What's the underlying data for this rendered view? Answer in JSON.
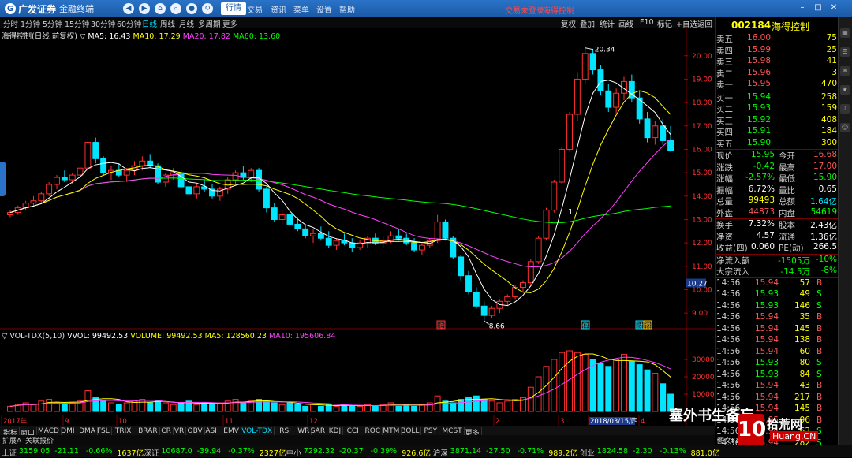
{
  "app": {
    "brand": "广发证券",
    "product": "金融终端"
  },
  "menu": [
    "行情",
    "交易",
    "资讯",
    "菜单",
    "设置",
    "帮助"
  ],
  "menu_active": "行情",
  "top_links": {
    "login": "交易未登录",
    "stock": "海得控制"
  },
  "periods": [
    "分时",
    "1分钟",
    "5分钟",
    "15分钟",
    "30分钟",
    "60分钟",
    "日线",
    "周线",
    "月线",
    "多周期",
    "更多"
  ],
  "period_active": "日线",
  "right_tools": [
    "复权",
    "叠加",
    "统计",
    "画线",
    "F10",
    "标记",
    "+自选",
    "返回"
  ],
  "stock": {
    "code": "002184",
    "name": "海得控制"
  },
  "chart_info": {
    "name": "海得控制(日线 前复权)",
    "ma5_label": "MA5: 16.43",
    "ma10_label": "MA10: 17.29",
    "ma20_label": "MA20: 17.82",
    "ma60_label": "MA60: 13.60"
  },
  "vol_info": {
    "name": "VOL-TDX(5,10)",
    "vvol": "VVOL: 99492.53",
    "volume": "VOLUME: 99492.53",
    "ma5": "MA5: 128560.23",
    "ma10": "MA10: 195606.84"
  },
  "annotations": {
    "high": "20.34",
    "low": "8.66",
    "cursor": "10.27",
    "marker1": "1",
    "ev1": "增",
    "ev2": "停",
    "ev3": "财",
    "ev4": "腾"
  },
  "price_axis": [
    "20.00",
    "19.00",
    "18.00",
    "17.00",
    "16.00",
    "15.00",
    "14.00",
    "13.00",
    "12.00",
    "11.00",
    "10.00",
    "9.00"
  ],
  "vol_axis": [
    "30000",
    "20000",
    "10000"
  ],
  "time_axis": [
    "2017年",
    "9",
    "10",
    "11",
    "12",
    "2",
    "3",
    "2018/03/15/四",
    "4"
  ],
  "tabs": [
    "指标",
    "窗口",
    "MACD",
    "DMI",
    "DMA",
    "FSL",
    "TRIX",
    "BRAR",
    "CR",
    "VR",
    "OBV",
    "ASI",
    "EMV",
    "VOL-TDX",
    "RSI",
    "WR",
    "SAR",
    "KDJ",
    "CCI",
    "ROC",
    "MTM",
    "BOLL",
    "PSY",
    "MCST",
    "更多"
  ],
  "tab_active": "VOL-TDX",
  "ext_bar": {
    "left": "扩展A",
    "mid": "关联报价"
  },
  "colors": {
    "up": "#ff3030",
    "down": "#00e5ff",
    "ma5": "#ffffff",
    "ma10": "#ffff00",
    "ma20": "#ff40ff",
    "ma60": "#00ff00"
  },
  "order_book": {
    "asks": [
      {
        "label": "卖五",
        "price": "16.00",
        "vol": "75"
      },
      {
        "label": "卖四",
        "price": "15.99",
        "vol": "25"
      },
      {
        "label": "卖三",
        "price": "15.98",
        "vol": "41"
      },
      {
        "label": "卖二",
        "price": "15.96",
        "vol": "3"
      },
      {
        "label": "卖一",
        "price": "15.95",
        "vol": "470"
      }
    ],
    "bids": [
      {
        "label": "买一",
        "price": "15.94",
        "vol": "258"
      },
      {
        "label": "买二",
        "price": "15.93",
        "vol": "159"
      },
      {
        "label": "买三",
        "price": "15.92",
        "vol": "408"
      },
      {
        "label": "买四",
        "price": "15.91",
        "vol": "184"
      },
      {
        "label": "买五",
        "price": "15.90",
        "vol": "300"
      }
    ]
  },
  "quote": [
    {
      "l1": "现价",
      "v1": "15.95",
      "l2": "今开",
      "v2": "16.68"
    },
    {
      "l1": "涨跌",
      "v1": "-0.42",
      "l2": "最高",
      "v2": "17.00"
    },
    {
      "l1": "涨幅",
      "v1": "-2.57%",
      "l2": "最低",
      "v2": "15.90"
    },
    {
      "l1": "振幅",
      "v1": "6.72%",
      "l2": "量比",
      "v2": "0.65"
    },
    {
      "l1": "总量",
      "v1": "99493",
      "l2": "总额",
      "v2": "1.64亿"
    },
    {
      "l1": "外盘",
      "v1": "44873",
      "l2": "内盘",
      "v2": "54619"
    },
    {
      "l1": "换手",
      "v1": "7.32%",
      "l2": "股本",
      "v2": "2.43亿"
    },
    {
      "l1": "净资",
      "v1": "4.57",
      "l2": "流通",
      "v2": "1.36亿"
    },
    {
      "l1": "收益(四)",
      "v1": "0.060",
      "l2": "PE(动)",
      "v2": "266.5"
    }
  ],
  "flows": [
    {
      "label": "净流入额",
      "v1": "-1505万",
      "v2": "-10%"
    },
    {
      "label": "大宗流入",
      "v1": "-14.5万",
      "v2": "-8%"
    }
  ],
  "ticks": [
    {
      "t": "14:56",
      "p": "15.94",
      "v": "57",
      "s": "B"
    },
    {
      "t": "14:56",
      "p": "15.93",
      "v": "49",
      "s": "S"
    },
    {
      "t": "14:56",
      "p": "15.93",
      "v": "146",
      "s": "S"
    },
    {
      "t": "14:56",
      "p": "15.94",
      "v": "35",
      "s": "B"
    },
    {
      "t": "14:56",
      "p": "15.94",
      "v": "145",
      "s": "B"
    },
    {
      "t": "14:56",
      "p": "15.94",
      "v": "138",
      "s": "B"
    },
    {
      "t": "14:56",
      "p": "15.94",
      "v": "60",
      "s": "B"
    },
    {
      "t": "14:56",
      "p": "15.93",
      "v": "80",
      "s": "S"
    },
    {
      "t": "14:56",
      "p": "15.93",
      "v": "84",
      "s": "S"
    },
    {
      "t": "14:56",
      "p": "15.94",
      "v": "43",
      "s": "B"
    },
    {
      "t": "14:56",
      "p": "15.94",
      "v": "217",
      "s": "B"
    },
    {
      "t": "14:56",
      "p": "15.94",
      "v": "145",
      "s": "B"
    },
    {
      "t": "14:56",
      "p": "15.95",
      "v": "96",
      "s": "B"
    },
    {
      "t": "14:56",
      "p": "15.94",
      "v": "63",
      "s": "S"
    },
    {
      "t": "14:56",
      "p": "15.94",
      "v": "282",
      "s": "S"
    }
  ],
  "right_bottom": {
    "f10": "图文F10",
    "pin": "笔"
  },
  "index_ticker": [
    {
      "name": "上证",
      "val": "3159.05",
      "chg": "-21.11",
      "pct": "-0.66%",
      "amt": "1637亿"
    },
    {
      "name": "深证",
      "val": "10687.0",
      "chg": "-39.94",
      "pct": "-0.37%",
      "amt": "2327亿"
    },
    {
      "name": "中小",
      "val": "7292.32",
      "chg": "-20.37",
      "pct": "-0.39%",
      "amt": "926.6亿"
    },
    {
      "name": "沪深",
      "val": "3871.14",
      "chg": "-27.50",
      "pct": "-0.71%",
      "amt": "989.2亿"
    },
    {
      "name": "创业",
      "val": "1824.58",
      "chg": "-2.30",
      "pct": "-0.13%",
      "amt": "881.0亿"
    }
  ],
  "watermark": {
    "text1": "塞外书生备忘",
    "text2": "拾荒网",
    "site": "Huang.CN",
    "num": "10"
  },
  "chart_data": {
    "type": "candlestick",
    "price_range": [
      8.5,
      20.7
    ],
    "ohlc": [
      [
        13.2,
        13.4,
        13.1,
        13.3
      ],
      [
        13.3,
        13.6,
        13.2,
        13.5
      ],
      [
        13.5,
        13.8,
        13.4,
        13.7
      ],
      [
        13.7,
        14.0,
        13.6,
        13.8
      ],
      [
        13.8,
        14.2,
        13.7,
        14.1
      ],
      [
        14.1,
        14.6,
        14.0,
        14.5
      ],
      [
        14.5,
        14.9,
        14.3,
        14.8
      ],
      [
        14.8,
        15.1,
        14.6,
        14.7
      ],
      [
        14.7,
        15.0,
        14.5,
        14.9
      ],
      [
        14.9,
        15.3,
        14.8,
        15.2
      ],
      [
        15.2,
        16.6,
        15.0,
        16.3
      ],
      [
        16.3,
        16.5,
        15.4,
        15.6
      ],
      [
        15.6,
        15.7,
        14.9,
        15.0
      ],
      [
        15.0,
        15.3,
        14.7,
        15.1
      ],
      [
        15.1,
        15.4,
        14.8,
        14.9
      ],
      [
        14.9,
        15.2,
        14.6,
        15.1
      ],
      [
        15.1,
        15.5,
        14.9,
        15.3
      ],
      [
        15.3,
        15.7,
        15.1,
        15.5
      ],
      [
        15.5,
        15.8,
        15.2,
        15.3
      ],
      [
        15.3,
        15.4,
        14.5,
        14.6
      ],
      [
        14.6,
        15.0,
        14.4,
        14.9
      ],
      [
        14.9,
        15.2,
        14.7,
        15.0
      ],
      [
        15.0,
        15.1,
        14.3,
        14.4
      ],
      [
        14.4,
        14.6,
        14.0,
        14.1
      ],
      [
        14.1,
        14.5,
        13.9,
        14.4
      ],
      [
        14.4,
        14.7,
        14.2,
        14.3
      ],
      [
        14.3,
        14.5,
        13.9,
        14.0
      ],
      [
        14.0,
        14.4,
        13.8,
        14.3
      ],
      [
        14.3,
        14.8,
        14.1,
        14.7
      ],
      [
        14.7,
        15.1,
        14.5,
        15.0
      ],
      [
        15.0,
        15.3,
        14.7,
        14.8
      ],
      [
        14.8,
        15.2,
        14.6,
        15.1
      ],
      [
        15.1,
        15.2,
        14.2,
        14.3
      ],
      [
        14.3,
        14.4,
        13.3,
        13.5
      ],
      [
        13.5,
        13.7,
        12.9,
        13.0
      ],
      [
        13.0,
        13.4,
        12.8,
        13.2
      ],
      [
        13.2,
        13.3,
        12.7,
        12.8
      ],
      [
        12.8,
        13.1,
        12.5,
        12.6
      ],
      [
        12.6,
        12.8,
        12.2,
        12.3
      ],
      [
        12.3,
        12.6,
        12.0,
        12.4
      ],
      [
        12.4,
        12.7,
        12.1,
        12.2
      ],
      [
        12.2,
        12.5,
        11.8,
        11.9
      ],
      [
        11.9,
        12.2,
        11.7,
        12.1
      ],
      [
        12.1,
        12.4,
        11.9,
        12.0
      ],
      [
        12.0,
        12.2,
        11.6,
        11.8
      ],
      [
        11.8,
        12.1,
        11.7,
        12.0
      ],
      [
        12.0,
        12.3,
        11.8,
        12.2
      ],
      [
        12.2,
        12.4,
        11.9,
        12.0
      ],
      [
        12.0,
        12.3,
        11.8,
        12.1
      ],
      [
        12.1,
        12.5,
        12.0,
        12.3
      ],
      [
        12.3,
        12.6,
        12.1,
        12.2
      ],
      [
        12.2,
        12.4,
        11.9,
        12.0
      ],
      [
        12.0,
        12.2,
        11.6,
        11.7
      ],
      [
        11.7,
        12.0,
        11.5,
        11.9
      ],
      [
        11.9,
        12.2,
        11.8,
        12.1
      ],
      [
        12.1,
        13.2,
        12.0,
        12.9
      ],
      [
        12.9,
        13.0,
        12.1,
        12.2
      ],
      [
        12.2,
        12.3,
        11.3,
        11.4
      ],
      [
        11.4,
        11.5,
        10.4,
        10.6
      ],
      [
        10.6,
        10.8,
        9.8,
        9.9
      ],
      [
        9.9,
        10.1,
        9.2,
        9.3
      ],
      [
        9.3,
        9.5,
        8.66,
        8.9
      ],
      [
        8.9,
        9.3,
        8.8,
        9.2
      ],
      [
        9.2,
        9.6,
        9.0,
        9.5
      ],
      [
        9.5,
        9.8,
        9.3,
        9.7
      ],
      [
        9.7,
        10.2,
        9.6,
        10.1
      ],
      [
        10.1,
        10.4,
        9.9,
        10.3
      ],
      [
        10.3,
        11.3,
        10.2,
        11.2
      ],
      [
        11.2,
        12.3,
        11.1,
        12.2
      ],
      [
        12.2,
        13.5,
        12.1,
        13.4
      ],
      [
        13.4,
        14.7,
        13.3,
        14.6
      ],
      [
        14.6,
        16.1,
        14.5,
        16.0
      ],
      [
        16.0,
        17.6,
        15.9,
        17.5
      ],
      [
        17.5,
        19.3,
        17.2,
        19.0
      ],
      [
        19.0,
        20.34,
        18.8,
        20.1
      ],
      [
        20.1,
        20.3,
        19.2,
        19.4
      ],
      [
        19.4,
        19.6,
        18.3,
        18.5
      ],
      [
        18.5,
        18.8,
        17.6,
        17.8
      ],
      [
        17.8,
        18.6,
        17.5,
        18.4
      ],
      [
        18.4,
        19.1,
        18.1,
        18.9
      ],
      [
        18.9,
        19.2,
        18.0,
        18.2
      ],
      [
        18.2,
        18.5,
        17.1,
        17.3
      ],
      [
        17.3,
        17.6,
        16.3,
        16.5
      ],
      [
        16.5,
        17.2,
        16.2,
        17.0
      ],
      [
        17.0,
        17.3,
        16.2,
        16.37
      ],
      [
        16.37,
        17.0,
        15.9,
        15.95
      ]
    ],
    "volume": [
      3,
      4,
      5,
      4,
      6,
      7,
      5,
      4,
      5,
      6,
      12,
      8,
      6,
      5,
      4,
      5,
      6,
      7,
      5,
      6,
      5,
      4,
      5,
      6,
      4,
      5,
      4,
      5,
      6,
      7,
      5,
      6,
      7,
      6,
      5,
      4,
      5,
      4,
      3,
      4,
      3,
      4,
      3,
      4,
      3,
      3,
      4,
      3,
      4,
      5,
      3,
      4,
      3,
      4,
      5,
      9,
      6,
      5,
      7,
      8,
      9,
      7,
      6,
      5,
      6,
      7,
      8,
      14,
      20,
      26,
      30,
      34,
      35,
      34,
      33,
      30,
      28,
      26,
      30,
      33,
      29,
      27,
      24,
      22,
      16,
      10
    ],
    "ma5": "series",
    "ma10": "series",
    "ma20": "series",
    "ma60": "series",
    "ylabel_units": "price",
    "vol_range": [
      0,
      40000
    ]
  }
}
